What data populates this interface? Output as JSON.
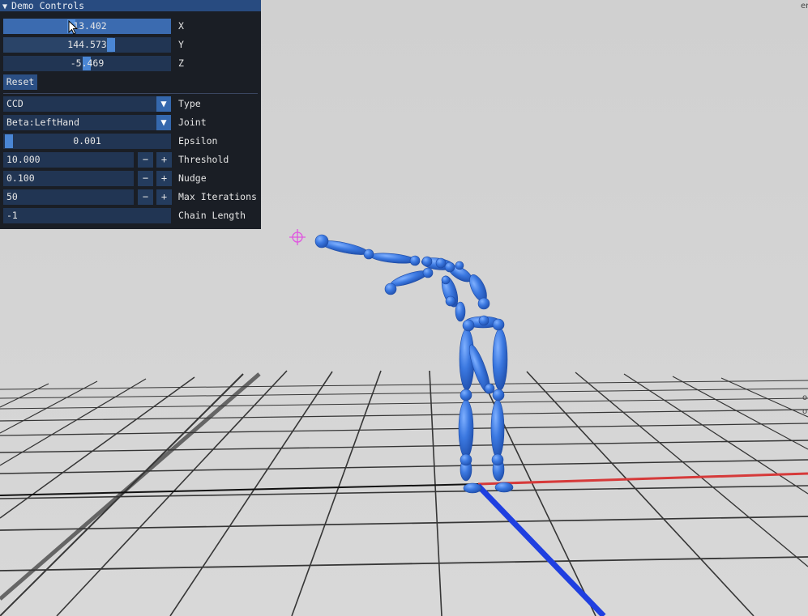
{
  "window": {
    "title": "Demo Controls"
  },
  "controls": {
    "x": {
      "label": "X",
      "value": "-13.402",
      "fill": 1.0
    },
    "y": {
      "label": "Y",
      "value": "144.573",
      "fill": 0.65
    },
    "z": {
      "label": "Z",
      "value": "-5.469",
      "fill": 0.48
    },
    "reset_label": "Reset",
    "type": {
      "label": "Type",
      "value": "CCD"
    },
    "joint": {
      "label": "Joint",
      "value": "Beta:LeftHand"
    },
    "epsilon": {
      "label": "Epsilon",
      "value": "0.001",
      "fill": 0.01
    },
    "threshold": {
      "label": "Threshold",
      "value": "10.000"
    },
    "nudge": {
      "label": "Nudge",
      "value": "0.100"
    },
    "max_iterations": {
      "label": "Max Iterations",
      "value": "50"
    },
    "chain_length": {
      "label": "Chain Length",
      "value": "-1"
    },
    "stepper_minus": "−",
    "stepper_plus": "+"
  },
  "scene": {
    "target_marker": "crosshair-icon",
    "character_color": "#3b78e0",
    "x_axis_color": "#d63a3a",
    "z_axis_color": "#1f3fe0",
    "grid_color": "#1a1a1a",
    "background": "#d3d3d3"
  },
  "edge_glyphs": [
    "er",
    "or",
    "or"
  ]
}
